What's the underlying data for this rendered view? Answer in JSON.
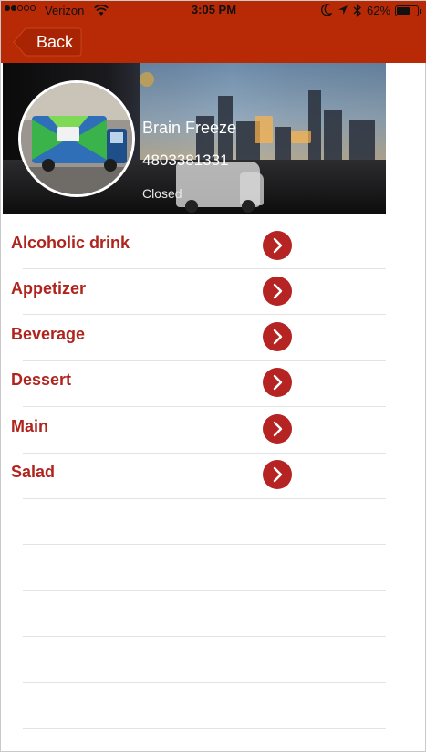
{
  "status_bar": {
    "carrier": "Verizon",
    "time": "3:05 PM",
    "battery_text": "62%",
    "battery_level": 0.62,
    "icons": [
      "signal-dots-icon",
      "wifi-icon",
      "moon-icon",
      "location-arrow-icon",
      "bluetooth-icon",
      "battery-icon"
    ]
  },
  "nav": {
    "back_label": "Back"
  },
  "truck": {
    "name": "Brain Freeze",
    "phone": "4803381331",
    "status": "Closed"
  },
  "categories": [
    {
      "label": "Alcoholic drink"
    },
    {
      "label": "Appetizer"
    },
    {
      "label": "Beverage"
    },
    {
      "label": "Dessert"
    },
    {
      "label": "Main"
    },
    {
      "label": "Salad"
    }
  ],
  "colors": {
    "nav_bar": "#b82a06",
    "category_text": "#b0241e",
    "chevron_button": "#b52422"
  }
}
